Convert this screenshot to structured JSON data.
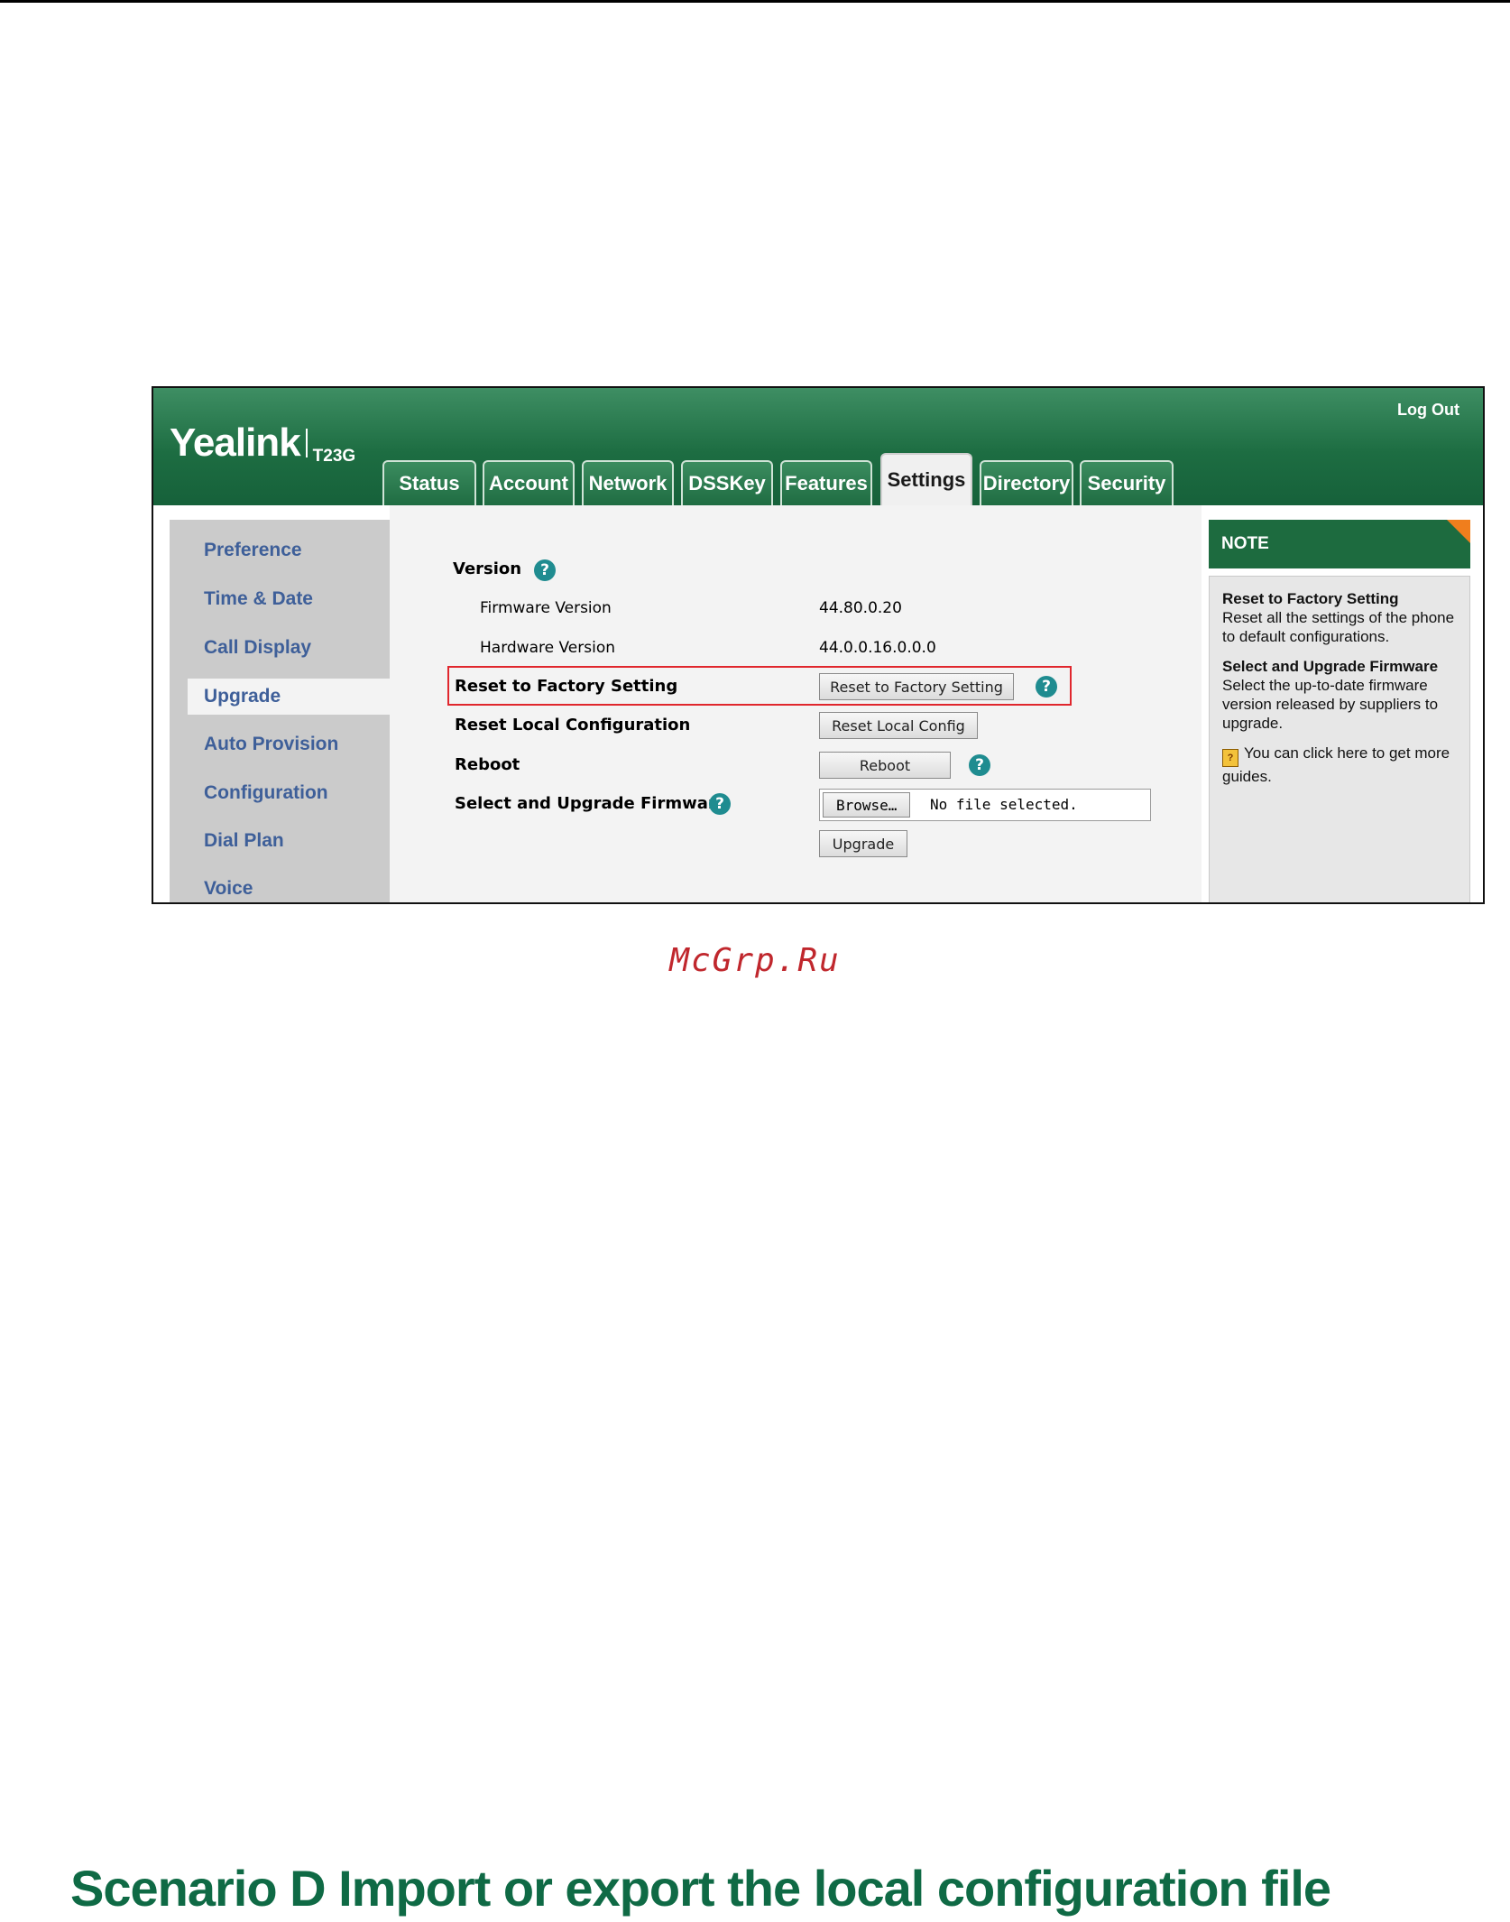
{
  "header": {
    "logo": "Yealink",
    "model": "T23G",
    "logout": "Log Out"
  },
  "tabs": [
    {
      "label": "Status"
    },
    {
      "label": "Account"
    },
    {
      "label": "Network"
    },
    {
      "label": "DSSKey"
    },
    {
      "label": "Features"
    },
    {
      "label": "Settings",
      "active": true
    },
    {
      "label": "Directory"
    },
    {
      "label": "Security"
    }
  ],
  "sidebar": {
    "items": [
      {
        "label": "Preference"
      },
      {
        "label": "Time & Date"
      },
      {
        "label": "Call Display"
      },
      {
        "label": "Upgrade",
        "active": true
      },
      {
        "label": "Auto Provision"
      },
      {
        "label": "Configuration"
      },
      {
        "label": "Dial Plan"
      },
      {
        "label": "Voice"
      }
    ]
  },
  "content": {
    "version_label": "Version",
    "firmware_label": "Firmware Version",
    "firmware_value": "44.80.0.20",
    "hardware_label": "Hardware Version",
    "hardware_value": "44.0.0.16.0.0.0",
    "reset_factory_label": "Reset to Factory Setting",
    "reset_factory_button": "Reset to Factory Setting",
    "reset_local_label": "Reset Local Configuration",
    "reset_local_button": "Reset Local Config",
    "reboot_label": "Reboot",
    "reboot_button": "Reboot",
    "upgrade_firmware_label": "Select and Upgrade Firmware",
    "browse_button": "Browse…",
    "no_file_text": "No file selected.",
    "upgrade_button": "Upgrade",
    "help_glyph": "?"
  },
  "note": {
    "title": "NOTE",
    "sections": [
      {
        "title": "Reset to Factory Setting",
        "text": "Reset all the settings of the phone to default configurations."
      },
      {
        "title": "Select and Upgrade Firmware",
        "text": "Select the up-to-date firmware version released by suppliers to upgrade."
      }
    ],
    "guide_text": "You can click here to get more guides."
  },
  "watermark": "McGrp.Ru",
  "page_heading": "Scenario D Import or export the local configuration file",
  "colors": {
    "brand_green": "#1d6d42",
    "highlight_red": "#e0262d",
    "help_teal": "#1f8c90",
    "note_corner_orange": "#f07e1d",
    "heading_green": "#0f6a45"
  }
}
